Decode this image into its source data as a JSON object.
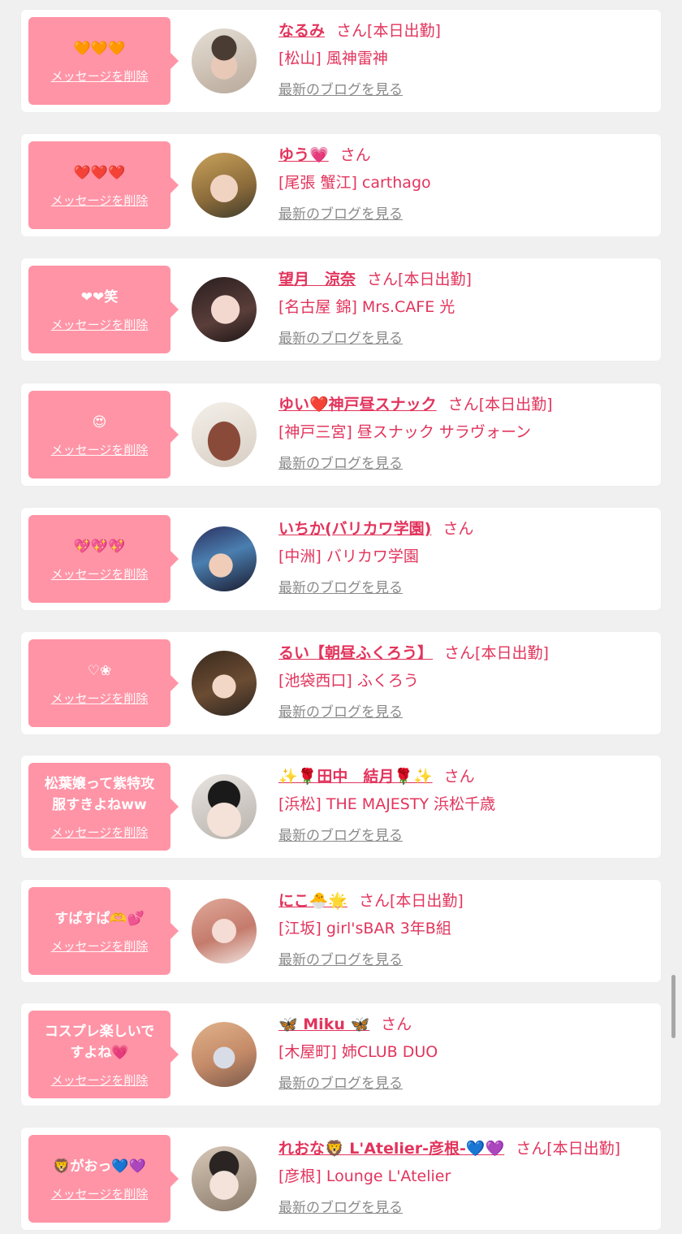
{
  "delete_label": "メッセージを削除",
  "blog_label": "最新のブログを見る",
  "san_label": "さん",
  "colors": {
    "background": "#f0f0f0",
    "bubble": "#ff94a6",
    "name": "#e2345c",
    "link_gray": "#8a8a8a"
  },
  "items": [
    {
      "message": "🧡🧡🧡",
      "name": "なるみ",
      "workday": "[本日出勤]",
      "shop": "[松山] 風神雷神"
    },
    {
      "message": "❤️❤️❤️",
      "name": "ゆう💗",
      "workday": "",
      "shop": "[尾張 蟹江] carthago"
    },
    {
      "message": "❤❤笑",
      "name": "望月　涼奈",
      "workday": "[本日出勤]",
      "shop": "[名古屋 錦] Mrs.CAFE 光"
    },
    {
      "message": "😍",
      "name": "ゆい❤️神戸昼スナック",
      "workday": "[本日出勤]",
      "shop": "[神戸三宮] 昼スナック サラヴォーン"
    },
    {
      "message": "💖💖💖",
      "name": "いちか(バリカワ学園)",
      "workday": "",
      "shop": "[中洲] バリカワ学園"
    },
    {
      "message": "♡❀",
      "name": "るい【朝昼ふくろう】",
      "workday": "[本日出勤]",
      "shop": "[池袋西口] ふくろう"
    },
    {
      "message": "松葉嬢って紫特攻\n服すきよねww",
      "name": "✨🌹田中　結月🌹✨",
      "workday": "",
      "shop": "[浜松] THE MAJESTY 浜松千歳"
    },
    {
      "message": "すぱすぱ🫶💕",
      "name": "にこ🐣🌟",
      "workday": "[本日出勤]",
      "shop": "[江坂] girl'sBAR 3年B組"
    },
    {
      "message": "コスプレ楽しいで\nすよね💗",
      "name": "🦋 Miku 🦋",
      "workday": "",
      "shop": "[木屋町] 姉CLUB DUO"
    },
    {
      "message": "🦁がおっ💙💜",
      "name": "れおな🦁 L'Atelier-彦根-💙💜",
      "workday": "[本日出勤]",
      "shop": "[彦根] Lounge L'Atelier"
    }
  ]
}
